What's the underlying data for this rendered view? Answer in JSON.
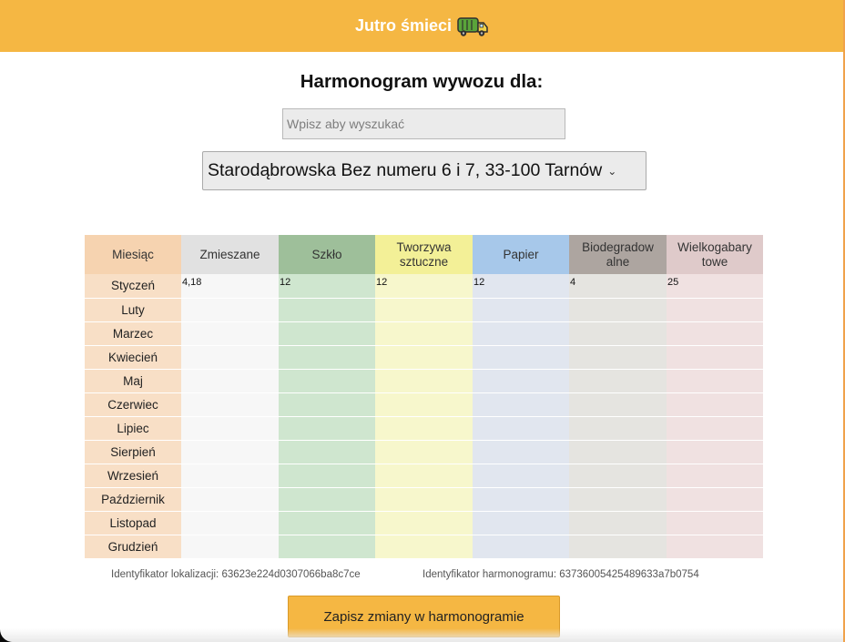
{
  "header": {
    "title": "Jutro śmieci",
    "icon": "garbage-truck-icon",
    "color": "#f5b743"
  },
  "page": {
    "heading": "Harmonogram wywozu dla:"
  },
  "search": {
    "placeholder": "Wpisz aby wyszukać",
    "value": ""
  },
  "address": {
    "selected": "Starodąbrowska Bez numeru 6 i 7, 33-100 Tarnów"
  },
  "schedule": {
    "columns": [
      {
        "label": "Miesiąc",
        "color": "#f6d3b0"
      },
      {
        "label": "Zmieszane",
        "color": "#e1e1e1"
      },
      {
        "label": "Szkło",
        "color": "#9ebf9a"
      },
      {
        "label": "Tworzywa sztuczne",
        "color": "#f3f097"
      },
      {
        "label": "Papier",
        "color": "#a7c8ea"
      },
      {
        "label": "Biodegradowalne",
        "color": "#ada5a0"
      },
      {
        "label": "Wielkogabarytowe",
        "color": "#dfcaca"
      }
    ],
    "rows": [
      {
        "month": "Styczeń",
        "values": [
          "4,18",
          "12",
          "12",
          "12",
          "4",
          "25"
        ]
      },
      {
        "month": "Luty",
        "values": [
          "",
          "",
          "",
          "",
          "",
          ""
        ]
      },
      {
        "month": "Marzec",
        "values": [
          "",
          "",
          "",
          "",
          "",
          ""
        ]
      },
      {
        "month": "Kwiecień",
        "values": [
          "",
          "",
          "",
          "",
          "",
          ""
        ]
      },
      {
        "month": "Maj",
        "values": [
          "",
          "",
          "",
          "",
          "",
          ""
        ]
      },
      {
        "month": "Czerwiec",
        "values": [
          "",
          "",
          "",
          "",
          "",
          ""
        ]
      },
      {
        "month": "Lipiec",
        "values": [
          "",
          "",
          "",
          "",
          "",
          ""
        ]
      },
      {
        "month": "Sierpień",
        "values": [
          "",
          "",
          "",
          "",
          "",
          ""
        ]
      },
      {
        "month": "Wrzesień",
        "values": [
          "",
          "",
          "",
          "",
          "",
          ""
        ]
      },
      {
        "month": "Październik",
        "values": [
          "",
          "",
          "",
          "",
          "",
          ""
        ]
      },
      {
        "month": "Listopad",
        "values": [
          "",
          "",
          "",
          "",
          "",
          ""
        ]
      },
      {
        "month": "Grudzień",
        "values": [
          "",
          "",
          "",
          "",
          "",
          ""
        ]
      }
    ]
  },
  "footer": {
    "location_id": "Identyfikator lokalizacji: 63623e224d0307066ba8c7ce",
    "schedule_id": "Identyfikator harmonogramu: 63736005425489633a7b0754",
    "save_label": "Zapisz zmiany w harmonogramie"
  }
}
